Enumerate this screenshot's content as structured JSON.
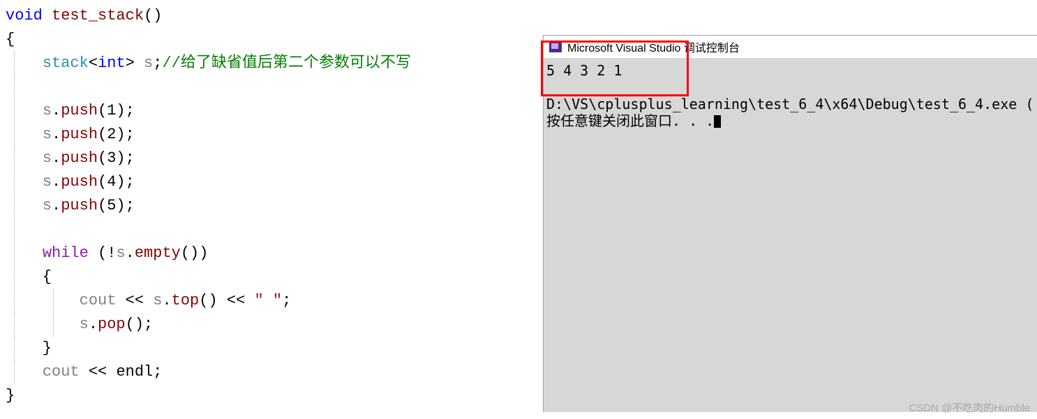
{
  "code": {
    "l1_void": "void",
    "l1_func": " test_stack",
    "l1_paren": "()",
    "l2": "{",
    "l3_indent": "    ",
    "l3_stack": "stack",
    "l3_lt": "<",
    "l3_int": "int",
    "l3_gt": ">",
    "l3_s": " s",
    "l3_semi": ";",
    "l3_comment": "//给了缺省值后第二个参数可以不写",
    "l5_indent": "    ",
    "l5_s": "s",
    "l5_dot": ".",
    "l5_push": "push",
    "l5_arg": "(1)",
    "l5_semi": ";",
    "l6_arg": "(2)",
    "l7_arg": "(3)",
    "l8_arg": "(4)",
    "l9_arg": "(5)",
    "l11_while": "while",
    "l11_open": " (!",
    "l11_s": "s",
    "l11_dot": ".",
    "l11_empty": "empty",
    "l11_close": "())",
    "l12": "    {",
    "l13_indent": "        ",
    "l13_cout": "cout",
    "l13_op1": " << ",
    "l13_s": "s",
    "l13_dot": ".",
    "l13_top": "top",
    "l13_paren": "()",
    "l13_op2": " << ",
    "l13_str": "\" \"",
    "l13_semi": ";",
    "l14_s": "s",
    "l14_dot": ".",
    "l14_pop": "pop",
    "l14_paren": "()",
    "l14_semi": ";",
    "l15": "    }",
    "l16_cout": "cout",
    "l16_op": " << ",
    "l16_endl": "endl",
    "l16_semi": ";",
    "l17": "}"
  },
  "console": {
    "title": "Microsoft Visual Studio 调试控制台",
    "output": "5 4 3 2 1",
    "path": "D:\\VS\\cplusplus_learning\\test_6_4\\x64\\Debug\\test_6_4.exe (",
    "prompt": "按任意键关闭此窗口. . ."
  },
  "watermark": "CSDN @不吃肉的Humble"
}
